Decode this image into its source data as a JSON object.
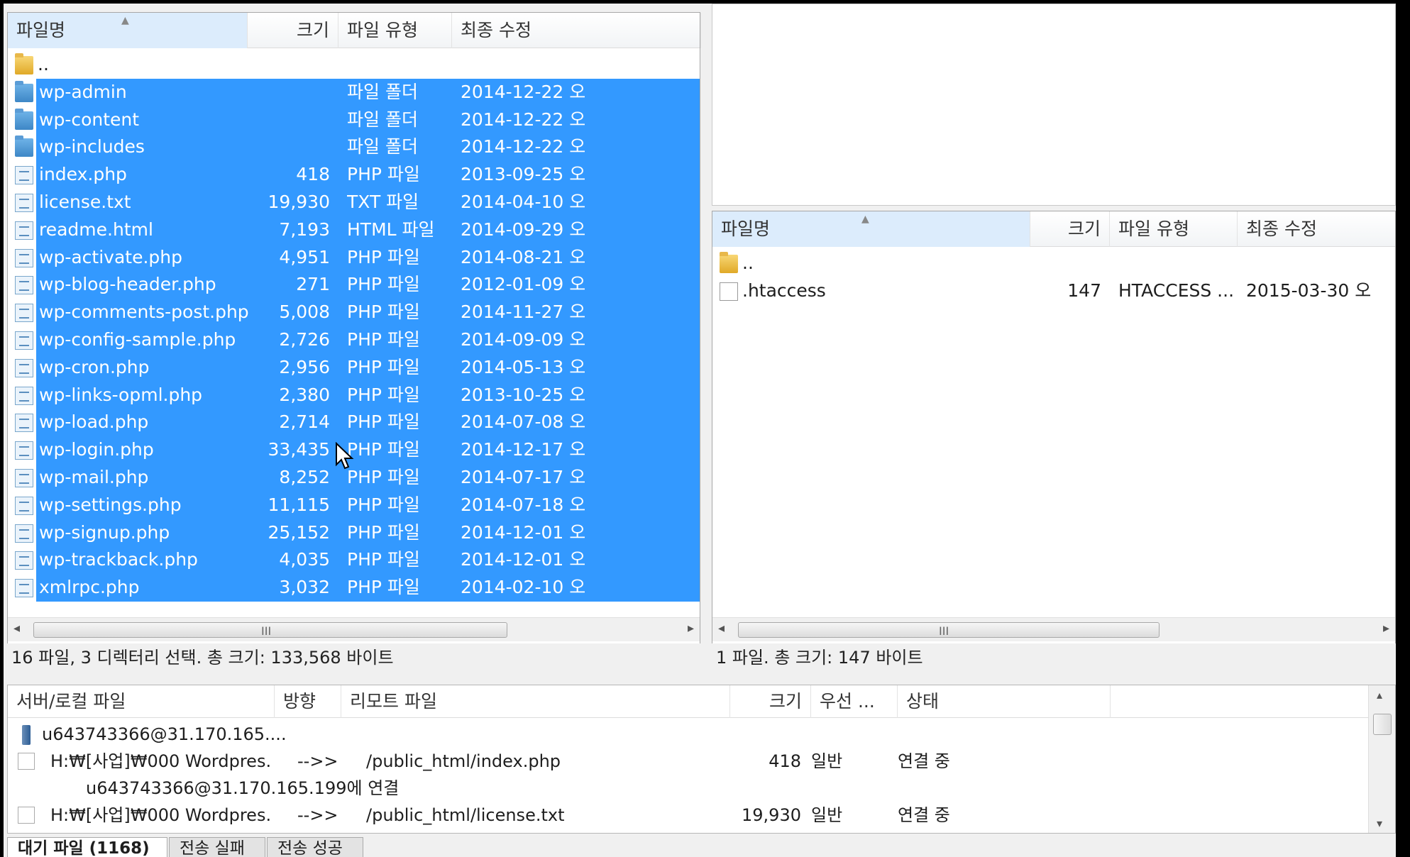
{
  "left_pane": {
    "headers": {
      "name": "파일명",
      "size": "크기",
      "type": "파일 유형",
      "modified": "최종 수정"
    },
    "parent": "..",
    "rows": [
      {
        "name": "wp-admin",
        "size": "",
        "type": "파일 폴더",
        "modified": "2014-12-22 오",
        "kind": "folder"
      },
      {
        "name": "wp-content",
        "size": "",
        "type": "파일 폴더",
        "modified": "2014-12-22 오",
        "kind": "folder"
      },
      {
        "name": "wp-includes",
        "size": "",
        "type": "파일 폴더",
        "modified": "2014-12-22 오",
        "kind": "folder"
      },
      {
        "name": "index.php",
        "size": "418",
        "type": "PHP 파일",
        "modified": "2013-09-25 오",
        "kind": "file"
      },
      {
        "name": "license.txt",
        "size": "19,930",
        "type": "TXT 파일",
        "modified": "2014-04-10 오",
        "kind": "file"
      },
      {
        "name": "readme.html",
        "size": "7,193",
        "type": "HTML 파일",
        "modified": "2014-09-29 오",
        "kind": "file"
      },
      {
        "name": "wp-activate.php",
        "size": "4,951",
        "type": "PHP 파일",
        "modified": "2014-08-21 오",
        "kind": "file"
      },
      {
        "name": "wp-blog-header.php",
        "size": "271",
        "type": "PHP 파일",
        "modified": "2012-01-09 오",
        "kind": "file"
      },
      {
        "name": "wp-comments-post.php",
        "size": "5,008",
        "type": "PHP 파일",
        "modified": "2014-11-27 오",
        "kind": "file"
      },
      {
        "name": "wp-config-sample.php",
        "size": "2,726",
        "type": "PHP 파일",
        "modified": "2014-09-09 오",
        "kind": "file"
      },
      {
        "name": "wp-cron.php",
        "size": "2,956",
        "type": "PHP 파일",
        "modified": "2014-05-13 오",
        "kind": "file"
      },
      {
        "name": "wp-links-opml.php",
        "size": "2,380",
        "type": "PHP 파일",
        "modified": "2013-10-25 오",
        "kind": "file"
      },
      {
        "name": "wp-load.php",
        "size": "2,714",
        "type": "PHP 파일",
        "modified": "2014-07-08 오",
        "kind": "file"
      },
      {
        "name": "wp-login.php",
        "size": "33,435",
        "type": "PHP 파일",
        "modified": "2014-12-17 오",
        "kind": "file"
      },
      {
        "name": "wp-mail.php",
        "size": "8,252",
        "type": "PHP 파일",
        "modified": "2014-07-17 오",
        "kind": "file"
      },
      {
        "name": "wp-settings.php",
        "size": "11,115",
        "type": "PHP 파일",
        "modified": "2014-07-18 오",
        "kind": "file"
      },
      {
        "name": "wp-signup.php",
        "size": "25,152",
        "type": "PHP 파일",
        "modified": "2014-12-01 오",
        "kind": "file"
      },
      {
        "name": "wp-trackback.php",
        "size": "4,035",
        "type": "PHP 파일",
        "modified": "2014-12-01 오",
        "kind": "file"
      },
      {
        "name": "xmlrpc.php",
        "size": "3,032",
        "type": "PHP 파일",
        "modified": "2014-02-10 오",
        "kind": "file"
      }
    ],
    "scroll_grip": "III",
    "status": "16 파일, 3 디렉터리 선택. 총 크기: 133,568 바이트"
  },
  "right_pane": {
    "headers": {
      "name": "파일명",
      "size": "크기",
      "type": "파일 유형",
      "modified": "최종 수정"
    },
    "parent": "..",
    "rows": [
      {
        "name": ".htaccess",
        "size": "147",
        "type": "HTACCESS ...",
        "modified": "2015-03-30 오"
      }
    ],
    "scroll_grip": "III",
    "status": "1 파일. 총 크기: 147 바이트"
  },
  "queue": {
    "headers": {
      "local": "서버/로컬 파일",
      "direction": "방향",
      "remote": "리모트 파일",
      "size": "크기",
      "priority": "우선 ...",
      "status": "상태"
    },
    "server": "u643743366@31.170.165....",
    "items": [
      {
        "local": "H:₩[사업]₩000 Wordpres...",
        "direction": "-->>",
        "remote": "/public_html/index.php",
        "size": "418",
        "priority": "일반",
        "status": "연결 중"
      },
      {
        "local": "H:₩[사업]₩000 Wordpres...",
        "direction": "-->>",
        "remote": "/public_html/license.txt",
        "size": "19,930",
        "priority": "일반",
        "status": "연결 중"
      }
    ],
    "connect_msg": "u643743366@31.170.165.199에 연결"
  },
  "tabs": [
    "대기 파일 (1168)",
    "전송 실패",
    "전송 성공"
  ]
}
